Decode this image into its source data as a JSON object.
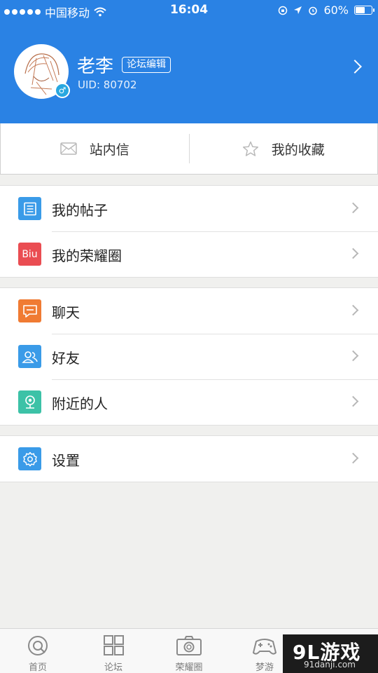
{
  "status_bar": {
    "carrier": "中国移动",
    "time": "16:04",
    "battery": "60%",
    "battery_level": 0.6
  },
  "profile": {
    "username": "老李",
    "role_badge": "论坛编辑",
    "uid": "UID: 80702"
  },
  "quick_actions": {
    "messages": "站内信",
    "favorites": "我的收藏"
  },
  "menu": {
    "group1": [
      {
        "label": "我的帖子",
        "icon": "document-icon",
        "icon_color": "#3a9be8"
      },
      {
        "label": "我的荣耀圈",
        "icon": "biu-icon",
        "icon_text": "Biu",
        "icon_color": "#ea4d52"
      }
    ],
    "group2": [
      {
        "label": "聊天",
        "icon": "chat-bubble-icon",
        "icon_color": "#f07b33"
      },
      {
        "label": "好友",
        "icon": "friends-icon",
        "icon_color": "#3a9be8"
      },
      {
        "label": "附近的人",
        "icon": "location-pin-icon",
        "icon_color": "#3cc2a7"
      }
    ],
    "group3": [
      {
        "label": "设置",
        "icon": "gear-icon",
        "icon_color": "#3a9be8"
      }
    ]
  },
  "tabs": [
    {
      "label": "首页",
      "icon": "home-icon"
    },
    {
      "label": "论坛",
      "icon": "grid-icon"
    },
    {
      "label": "荣耀圈",
      "icon": "camera-icon"
    },
    {
      "label": "梦游",
      "icon": "gamepad-icon"
    }
  ],
  "watermark": {
    "main": "9L游戏",
    "sub": "91danji.com"
  },
  "colors": {
    "header_blue": "#2a82e4",
    "background": "#f0f0ee"
  }
}
